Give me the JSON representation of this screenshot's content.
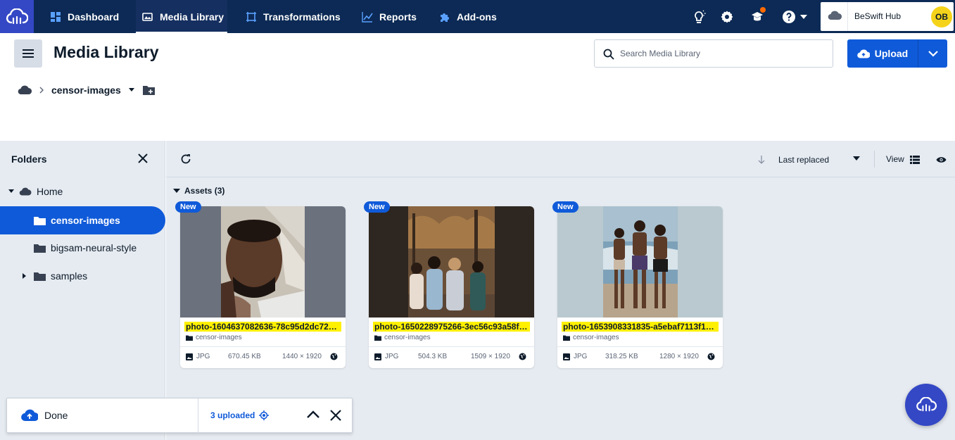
{
  "nav": {
    "items": [
      {
        "label": "Dashboard",
        "icon": "dashboard-grid-icon"
      },
      {
        "label": "Media Library",
        "icon": "image-gallery-icon",
        "active": true
      },
      {
        "label": "Transformations",
        "icon": "transform-frame-icon"
      },
      {
        "label": "Reports",
        "icon": "line-chart-icon"
      },
      {
        "label": "Add-ons",
        "icon": "puzzle-icon"
      }
    ],
    "account_name": "BeSwift Hub",
    "avatar_initials": "OB"
  },
  "header": {
    "title": "Media Library",
    "search_placeholder": "Search Media Library",
    "upload_label": "Upload"
  },
  "breadcrumb": {
    "folder": "censor-images"
  },
  "sidebar": {
    "title": "Folders",
    "items": [
      {
        "label": "Home"
      },
      {
        "label": "censor-images",
        "active": true
      },
      {
        "label": "bigsam-neural-style"
      },
      {
        "label": "samples"
      }
    ]
  },
  "toolbar": {
    "sort_label": "Last replaced",
    "view_label": "View"
  },
  "assets": {
    "heading": "Assets (3)",
    "cards": [
      {
        "badge": "New",
        "name": "photo-1604637082636-78c95d2dc728_...",
        "folder": "censor-images",
        "format": "JPG",
        "size": "670.45 KB",
        "dims": "1440 × 1920"
      },
      {
        "badge": "New",
        "name": "photo-1650228975266-3ec56c93a58f_...",
        "folder": "censor-images",
        "format": "JPG",
        "size": "504.3 KB",
        "dims": "1509 × 1920"
      },
      {
        "badge": "New",
        "name": "photo-1653908331835-a5ebaf7113f1_s...",
        "folder": "censor-images",
        "format": "JPG",
        "size": "318.25 KB",
        "dims": "1280 × 1920"
      }
    ]
  },
  "toast": {
    "status": "Done",
    "uploaded": "3 uploaded"
  },
  "colors": {
    "nav_bg": "#0c2a55",
    "brand_blue": "#3448c5",
    "accent_blue": "#0f5ad9",
    "highlight": "#fff000",
    "panel_bg": "#e6ebf1"
  }
}
